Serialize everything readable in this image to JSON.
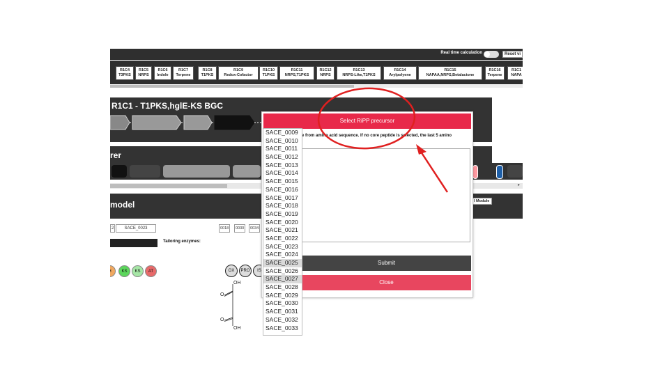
{
  "header": {
    "realtime_label": "Real time calculation",
    "reset_label": "Reset vi"
  },
  "regions": [
    {
      "line1": "R1C4",
      "line2": "T3PKS"
    },
    {
      "line1": "R1C5",
      "line2": "NRPS"
    },
    {
      "line1": "R1C6",
      "line2": "Indole"
    },
    {
      "line1": "R1C7",
      "line2": "Terpene"
    },
    {
      "line1": "R1C8",
      "line2": "T1PKS"
    },
    {
      "line1": "R1C9",
      "line2": "Redox-Cofactor"
    },
    {
      "line1": "R1C10",
      "line2": "T1PKS"
    },
    {
      "line1": "R1C11",
      "line2": "NRPS,T1PKS"
    },
    {
      "line1": "R1C12",
      "line2": "NRPS"
    },
    {
      "line1": "R1C13",
      "line2": "NRPS-Like,T1PKS"
    },
    {
      "line1": "R1C14",
      "line2": "Arylpolyene"
    },
    {
      "line1": "R1C15",
      "line2": "NAPAA,NRPS,Betalactone"
    },
    {
      "line1": "R1C16",
      "line2": "Terpene"
    },
    {
      "line1": "R1C1",
      "line2": "NAPA"
    }
  ],
  "bgc": {
    "title": "R1C1 - T1PKS,hglE-KS BGC"
  },
  "panel2": {
    "title": "rer"
  },
  "model": {
    "title": "model",
    "button_label": "l Module"
  },
  "core": {
    "index_label": "2",
    "selected_gene": "SACE_0023",
    "selected_ids": [
      "0018",
      "0030",
      "0034"
    ],
    "tailoring_label": "Tailoring enzymes:"
  },
  "domains": [
    {
      "label": "H",
      "color": "#f0a860"
    },
    {
      "label": "KS",
      "color": "#5cd65c"
    },
    {
      "label": "KS",
      "color": "#a6e6a6"
    },
    {
      "label": "AT",
      "color": "#e86a6a"
    }
  ],
  "enzymes": [
    "OX",
    "PRO",
    "IS"
  ],
  "molecule": {
    "oh_top": "OH",
    "o1": "O",
    "o2": "O",
    "oh_bottom": "OH"
  },
  "modal": {
    "title": "Select RiPP precursor",
    "description": "e from amino acid sequence. If no core peptide is selected, the last 5 amino",
    "textarea_value": "",
    "submit_label": "Submit",
    "close_label": "Close"
  },
  "dropdown": {
    "items": [
      "SACE_0009",
      "SACE_0010",
      "SACE_0011",
      "SACE_0012",
      "SACE_0013",
      "SACE_0014",
      "SACE_0015",
      "SACE_0016",
      "SACE_0017",
      "SACE_0018",
      "SACE_0019",
      "SACE_0020",
      "SACE_0021",
      "SACE_0022",
      "SACE_0023",
      "SACE_0024",
      "SACE_0025",
      "SACE_0026",
      "SACE_0027",
      "SACE_0028",
      "SACE_0029",
      "SACE_0030",
      "SACE_0031",
      "SACE_0032",
      "SACE_0033"
    ],
    "highlighted": [
      "SACE_0025",
      "SACE_0027"
    ]
  },
  "colors": {
    "accent_red": "#e8294a",
    "annotation_red": "#e02020",
    "panel_dark": "#333333"
  }
}
